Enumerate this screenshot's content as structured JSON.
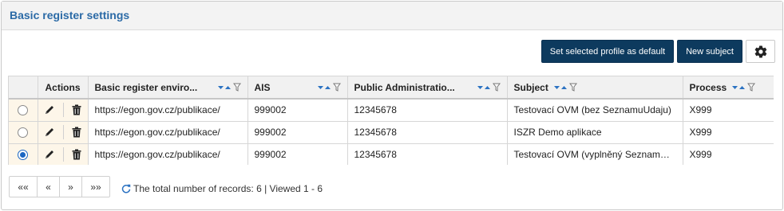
{
  "panel": {
    "title": "Basic register settings"
  },
  "toolbar": {
    "default_profile_label": "Set selected profile as default",
    "new_subject_label": "New subject",
    "settings_icon": "gear-icon"
  },
  "grid": {
    "columns": [
      {
        "label": "Actions"
      },
      {
        "label": "Basic register enviro..."
      },
      {
        "label": "AIS"
      },
      {
        "label": "Public Administratio..."
      },
      {
        "label": "Subject"
      },
      {
        "label": "Process"
      }
    ],
    "rows": [
      {
        "selected": false,
        "env": "https://egon.gov.cz/publikace/",
        "ais": "999002",
        "public_admin": "12345678",
        "subject": "Testovací OVM (bez SeznamuUdaju)",
        "process": "X999"
      },
      {
        "selected": false,
        "env": "https://egon.gov.cz/publikace/",
        "ais": "999002",
        "public_admin": "12345678",
        "subject": "ISZR Demo aplikace",
        "process": "X999"
      },
      {
        "selected": true,
        "env": "https://egon.gov.cz/publikace/",
        "ais": "999002",
        "public_admin": "12345678",
        "subject": "Testovací OVM (vyplněný SeznamUd...",
        "process": "X999"
      }
    ],
    "accent_color": "#1a66c2"
  },
  "pager": {
    "first": "««",
    "prev": "«",
    "next": "»",
    "last": "»»",
    "records_text": "The total number of records: 6 | Viewed 1 - 6"
  }
}
